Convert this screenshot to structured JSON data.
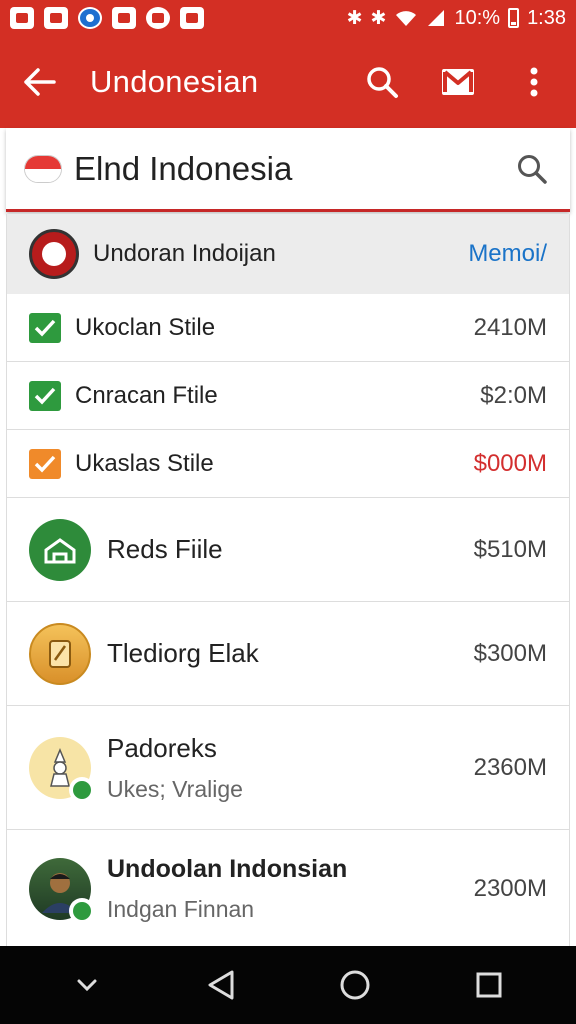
{
  "status_bar": {
    "battery": "10:%",
    "time": "1:38",
    "left_icons": [
      "gallery-notification-icon",
      "calendar-notification-icon",
      "browser-notification-icon",
      "chat-notification-icon",
      "record-notification-icon",
      "mail-notification-icon"
    ]
  },
  "app_bar": {
    "title": "Undonesian",
    "icons": [
      "back-arrow-icon",
      "search-icon",
      "gmail-icon",
      "overflow-menu-icon"
    ]
  },
  "search_bar": {
    "query": "Elnd Indonesia"
  },
  "list_header": {
    "title": "Undoran Indoijan",
    "action": "Memoi/"
  },
  "rows": [
    {
      "label": "Ukoclan Stile",
      "amount": "2410M",
      "check": "green"
    },
    {
      "label": "Cnracan Ftile",
      "amount": "$2:0M",
      "check": "green"
    },
    {
      "label": "Ukaslas Stile",
      "amount": "$000M",
      "check": "orange",
      "amount_color": "#d32f2f"
    },
    {
      "label": "Reds Fiile",
      "amount": "$510M"
    },
    {
      "label": "Tlediorg Elak",
      "amount": "$300M"
    },
    {
      "label": "Padoreks",
      "sub": "Ukes; Vralige",
      "amount": "2360M"
    },
    {
      "label": "Undoolan Indonsian",
      "sub": "Indgan Finnan",
      "amount": "2300M"
    }
  ],
  "colors": {
    "primary": "#d32f24",
    "check_green": "#2e9a3e",
    "check_orange": "#f08a2a",
    "link_blue": "#1a73c8"
  },
  "nav_bar": {
    "icons": [
      "hide-keyboard-icon",
      "back-nav-icon",
      "home-nav-icon",
      "recents-nav-icon"
    ]
  }
}
